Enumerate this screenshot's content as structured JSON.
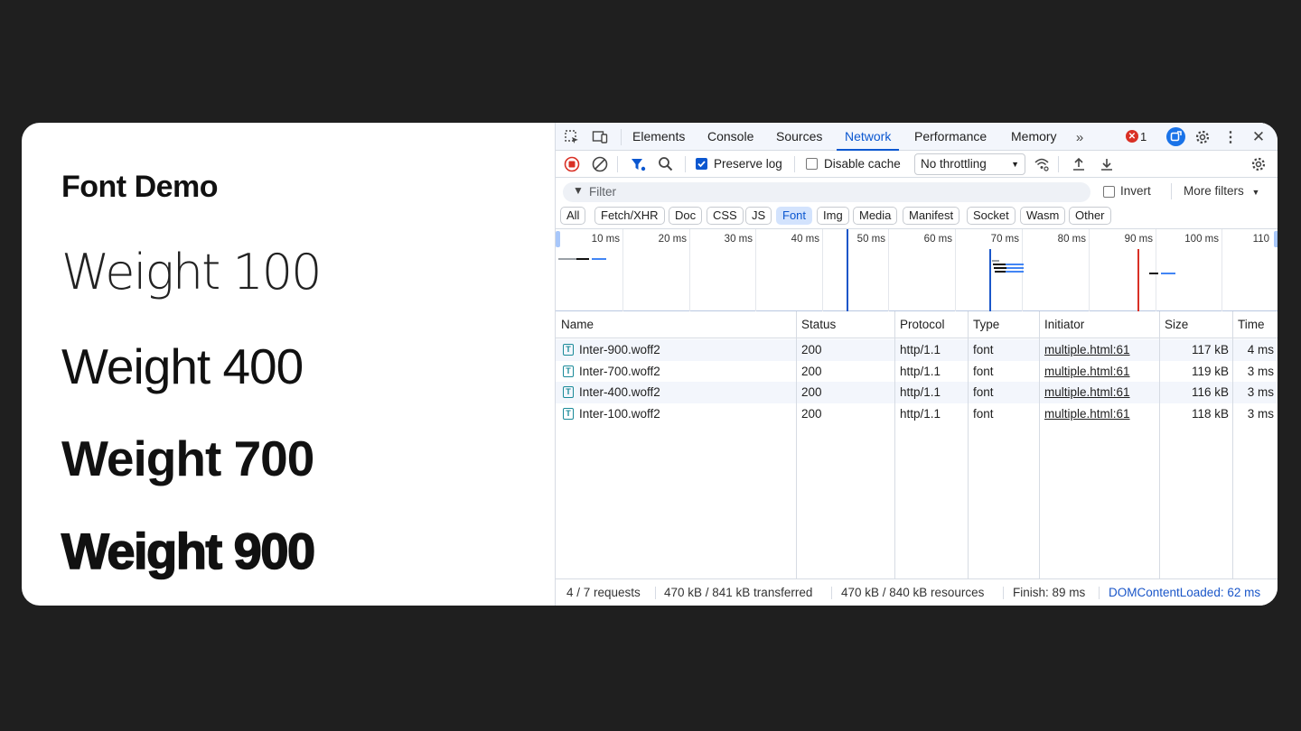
{
  "page": {
    "title": "Font Demo",
    "weights": [
      "Weight 100",
      "Weight 400",
      "Weight 700",
      "Weight 900"
    ]
  },
  "devtools": {
    "tabs": [
      "Elements",
      "Console",
      "Sources",
      "Network",
      "Performance",
      "Memory"
    ],
    "active_tab": "Network",
    "error_count": "1",
    "toolbar": {
      "preserve_log": "Preserve log",
      "preserve_log_checked": true,
      "disable_cache": "Disable cache",
      "disable_cache_checked": false,
      "throttling": "No throttling"
    },
    "filter": {
      "placeholder": "Filter",
      "invert": "Invert",
      "more_filters": "More filters"
    },
    "type_filters": [
      "All",
      "Fetch/XHR",
      "Doc",
      "CSS",
      "JS",
      "Font",
      "Img",
      "Media",
      "Manifest",
      "Socket",
      "Wasm",
      "Other"
    ],
    "active_type_filter": "Font",
    "timeline_ticks": [
      "10 ms",
      "20 ms",
      "30 ms",
      "40 ms",
      "50 ms",
      "60 ms",
      "70 ms",
      "80 ms",
      "90 ms",
      "100 ms",
      "110"
    ],
    "columns": [
      "Name",
      "Status",
      "Protocol",
      "Type",
      "Initiator",
      "Size",
      "Time"
    ],
    "rows": [
      {
        "name": "Inter-900.woff2",
        "status": "200",
        "protocol": "http/1.1",
        "type": "font",
        "initiator": "multiple.html:61",
        "size": "117 kB",
        "time": "4 ms"
      },
      {
        "name": "Inter-700.woff2",
        "status": "200",
        "protocol": "http/1.1",
        "type": "font",
        "initiator": "multiple.html:61",
        "size": "119 kB",
        "time": "3 ms"
      },
      {
        "name": "Inter-400.woff2",
        "status": "200",
        "protocol": "http/1.1",
        "type": "font",
        "initiator": "multiple.html:61",
        "size": "116 kB",
        "time": "3 ms"
      },
      {
        "name": "Inter-100.woff2",
        "status": "200",
        "protocol": "http/1.1",
        "type": "font",
        "initiator": "multiple.html:61",
        "size": "118 kB",
        "time": "3 ms"
      }
    ],
    "status_bar": {
      "requests": "4 / 7 requests",
      "transferred": "470 kB / 841 kB transferred",
      "resources": "470 kB / 840 kB resources",
      "finish": "Finish: 89 ms",
      "dcl": "DOMContentLoaded: 62 ms"
    },
    "colors": {
      "accent": "#0b57d0",
      "dcl_line": "#1a56c9",
      "load_line": "#d93025"
    }
  }
}
